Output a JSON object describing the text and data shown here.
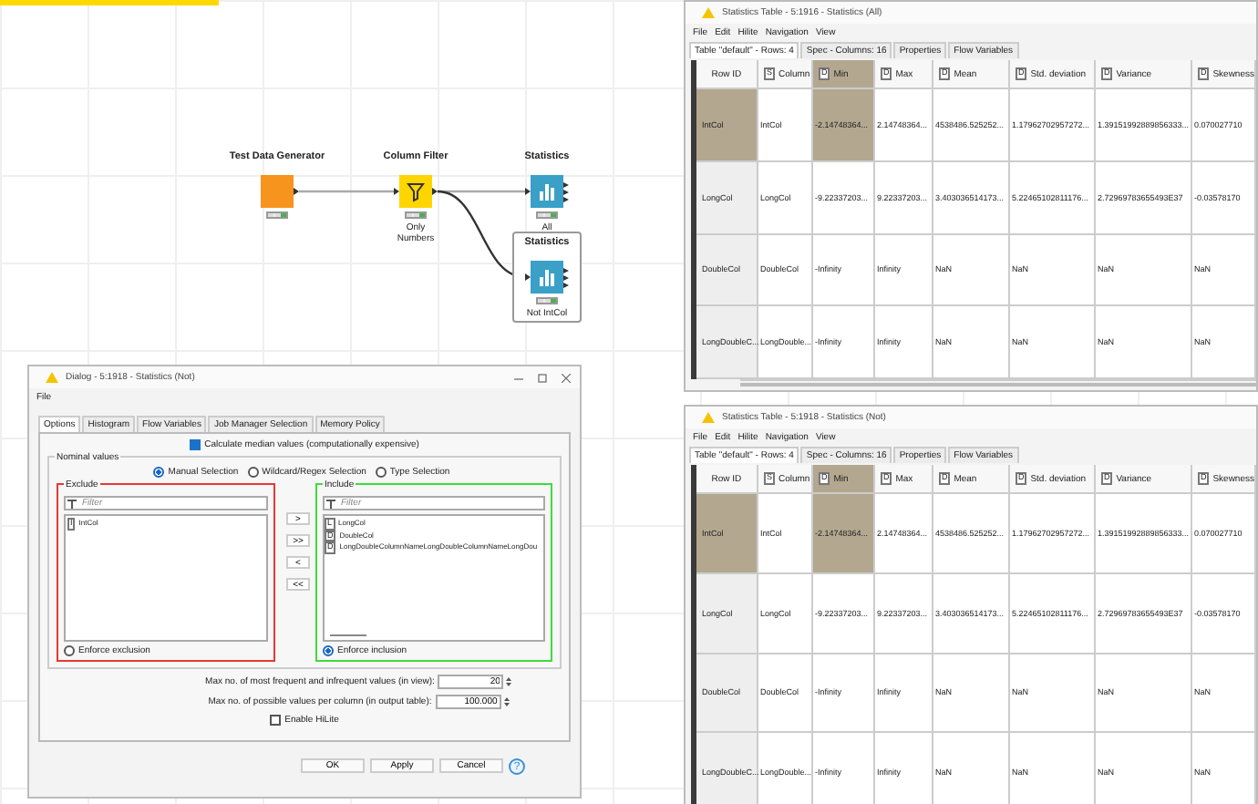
{
  "workflow": {
    "nodes": [
      {
        "name": "Test Data Generator",
        "kind": "source",
        "color": "#f7941d",
        "selected": false
      },
      {
        "name": "Column Filter",
        "kind": "manipulator",
        "color": "#ffd500",
        "selected": false,
        "label": "Only Numbers"
      },
      {
        "name": "Statistics",
        "kind": "statistics",
        "color": "#3aa0c8",
        "selected": false,
        "label": "All"
      },
      {
        "name": "Statistics",
        "kind": "statistics",
        "color": "#3aa0c8",
        "selected": true,
        "label": "Not IntCol"
      }
    ]
  },
  "dialog": {
    "title": "Dialog - 5:1918 - Statistics (Not)",
    "menu": [
      "File"
    ],
    "tabs": [
      {
        "label": "Options",
        "selected": true
      },
      {
        "label": "Histogram",
        "selected": false
      },
      {
        "label": "Flow Variables",
        "selected": false
      },
      {
        "label": "Job Manager Selection",
        "selected": false
      },
      {
        "label": "Memory Policy",
        "selected": false
      }
    ],
    "median_checkbox": {
      "label": "Calculate median values (computationally expensive)",
      "checked": true
    },
    "group_title": "Nominal values",
    "selection_modes": [
      {
        "label": "Manual Selection",
        "selected": true
      },
      {
        "label": "Wildcard/Regex Selection",
        "selected": false
      },
      {
        "label": "Type Selection",
        "selected": false
      }
    ],
    "exclude": {
      "title": "Exclude",
      "placeholder": "Filter",
      "items": [
        {
          "type": "I",
          "name": "IntCol"
        }
      ],
      "enforce": {
        "label": "Enforce exclusion",
        "selected": false
      }
    },
    "transfer_buttons": [
      ">",
      ">>",
      "<",
      "<<"
    ],
    "include": {
      "title": "Include",
      "placeholder": "Filter",
      "items": [
        {
          "type": "L",
          "name": "LongCol"
        },
        {
          "type": "D",
          "name": "DoubleCol"
        },
        {
          "type": "D",
          "name": "LongDoubleColumnNameLongDoubleColumnNameLongDou"
        }
      ],
      "enforce": {
        "label": "Enforce inclusion",
        "selected": true
      }
    },
    "fields": [
      {
        "label": "Max no. of most frequent and infrequent values (in view):",
        "value": "20"
      },
      {
        "label": "Max no. of possible values per column (in output table):",
        "value": "100.000"
      }
    ],
    "hilite_checkbox": {
      "label": "Enable HiLite",
      "checked": false
    },
    "buttons": [
      "OK",
      "Apply",
      "Cancel"
    ],
    "help": "?"
  },
  "tables": [
    {
      "title": "Statistics Table - 5:1916 - Statistics (All)",
      "menu": [
        "File",
        "Edit",
        "Hilite",
        "Navigation",
        "View"
      ],
      "tabs": [
        {
          "label": "Table \"default\" - Rows: 4",
          "selected": true
        },
        {
          "label": "Spec - Columns: 16",
          "selected": false
        },
        {
          "label": "Properties",
          "selected": false
        },
        {
          "label": "Flow Variables",
          "selected": false
        }
      ],
      "columns": [
        {
          "label": "Row ID",
          "selected": false
        },
        {
          "type": "S",
          "label": "Column",
          "selected": false
        },
        {
          "type": "D",
          "label": "Min",
          "selected": true
        },
        {
          "type": "D",
          "label": "Max",
          "selected": false
        },
        {
          "type": "D",
          "label": "Mean",
          "selected": false
        },
        {
          "type": "D",
          "label": "Std. deviation",
          "selected": false
        },
        {
          "type": "D",
          "label": "Variance",
          "selected": false
        },
        {
          "type": "D",
          "label": "Skewness",
          "selected": false
        }
      ],
      "rows": [
        {
          "selected": true,
          "cells": [
            "IntCol",
            "IntCol",
            "-2.14748364...",
            "2.14748364...",
            "4538486.525252...",
            "1.17962702957272...",
            "1.39151992889856333...",
            "0.070027710"
          ]
        },
        {
          "selected": false,
          "cells": [
            "LongCol",
            "LongCol",
            "-9.22337203...",
            "9.22337203...",
            "3.403036514173...",
            "5.22465102811176...",
            "2.72969783655493E37",
            "-0.03578170"
          ]
        },
        {
          "selected": false,
          "cells": [
            "DoubleCol",
            "DoubleCol",
            "-Infinity",
            "Infinity",
            "NaN",
            "NaN",
            "NaN",
            "NaN"
          ]
        },
        {
          "selected": false,
          "cells": [
            "LongDoubleC...",
            "LongDouble...",
            "-Infinity",
            "Infinity",
            "NaN",
            "NaN",
            "NaN",
            "NaN"
          ]
        }
      ]
    },
    {
      "title": "Statistics Table - 5:1918 - Statistics (Not)",
      "menu": [
        "File",
        "Edit",
        "Hilite",
        "Navigation",
        "View"
      ],
      "tabs": [
        {
          "label": "Table \"default\" - Rows: 4",
          "selected": true
        },
        {
          "label": "Spec - Columns: 16",
          "selected": false
        },
        {
          "label": "Properties",
          "selected": false
        },
        {
          "label": "Flow Variables",
          "selected": false
        }
      ],
      "columns": [
        {
          "label": "Row ID",
          "selected": false
        },
        {
          "type": "S",
          "label": "Column",
          "selected": false
        },
        {
          "type": "D",
          "label": "Min",
          "selected": true
        },
        {
          "type": "D",
          "label": "Max",
          "selected": false
        },
        {
          "type": "D",
          "label": "Mean",
          "selected": false
        },
        {
          "type": "D",
          "label": "Std. deviation",
          "selected": false
        },
        {
          "type": "D",
          "label": "Variance",
          "selected": false
        },
        {
          "type": "D",
          "label": "Skewness",
          "selected": false
        }
      ],
      "rows": [
        {
          "selected": true,
          "cells": [
            "IntCol",
            "IntCol",
            "-2.14748364...",
            "2.14748364...",
            "4538486.525252...",
            "1.17962702957272...",
            "1.39151992889856333...",
            "0.070027710"
          ]
        },
        {
          "selected": false,
          "cells": [
            "LongCol",
            "LongCol",
            "-9.22337203...",
            "9.22337203...",
            "3.403036514173...",
            "5.22465102811176...",
            "2.72969783655493E37",
            "-0.03578170"
          ]
        },
        {
          "selected": false,
          "cells": [
            "DoubleCol",
            "DoubleCol",
            "-Infinity",
            "Infinity",
            "NaN",
            "NaN",
            "NaN",
            "NaN"
          ]
        },
        {
          "selected": false,
          "cells": [
            "LongDoubleC...",
            "LongDouble...",
            "-Infinity",
            "Infinity",
            "NaN",
            "NaN",
            "NaN",
            "NaN"
          ]
        }
      ]
    }
  ]
}
